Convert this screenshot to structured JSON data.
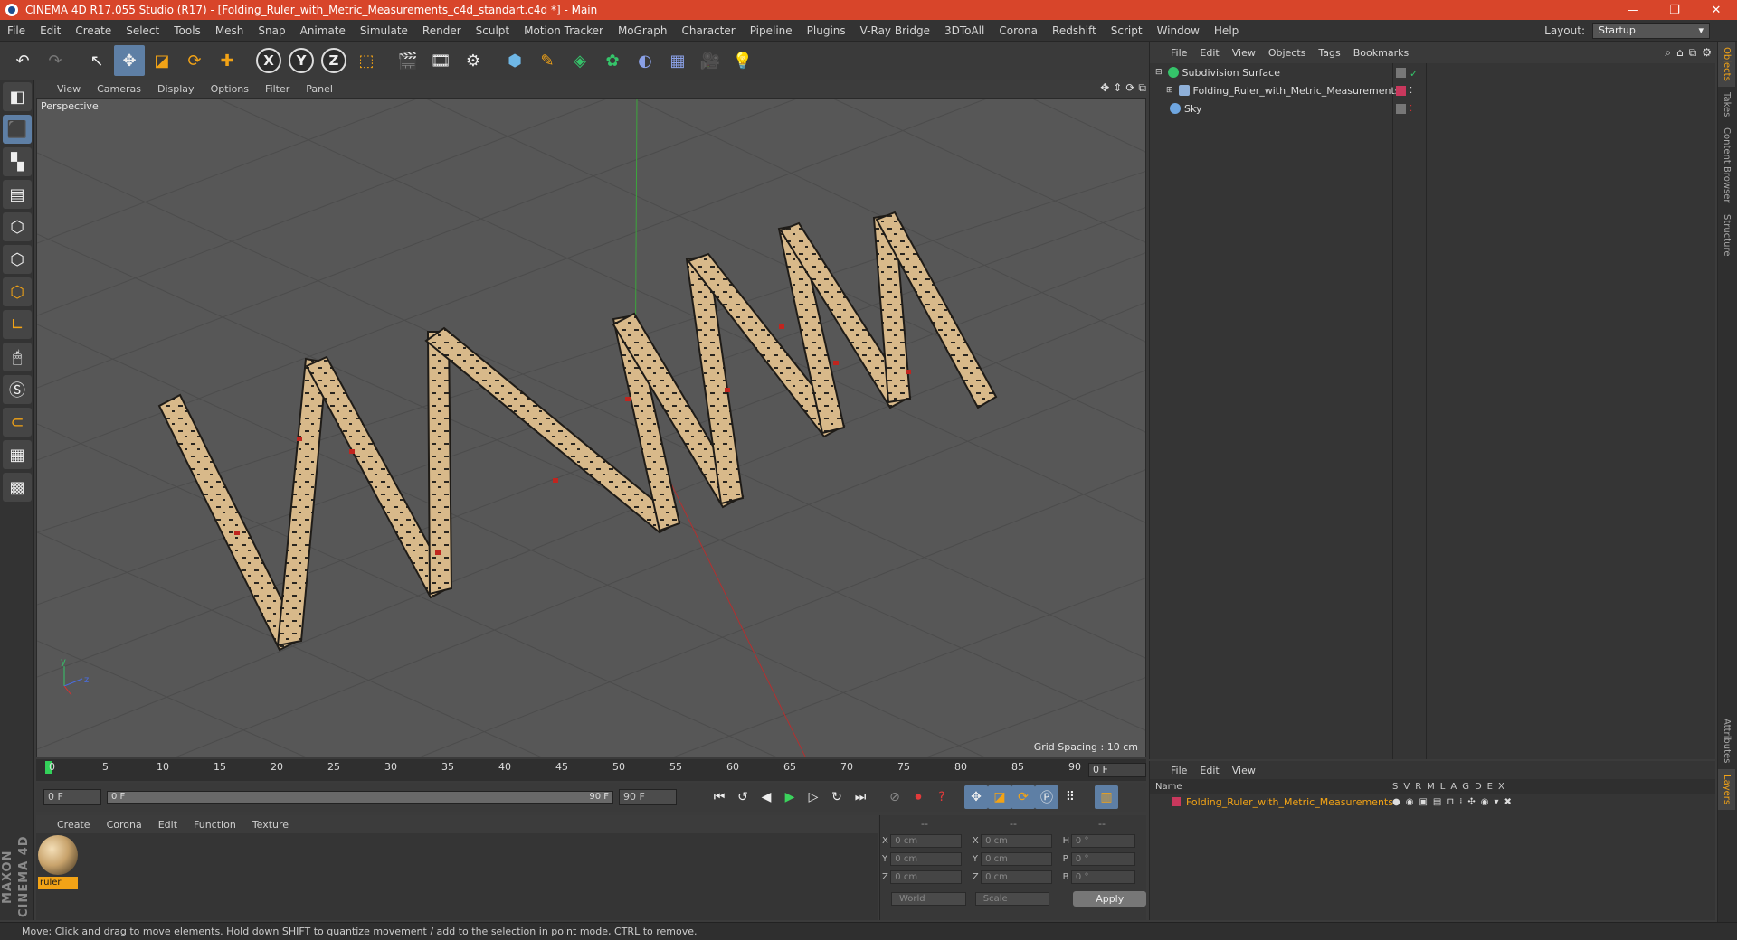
{
  "window": {
    "title": "CINEMA 4D R17.055 Studio (R17) - [Folding_Ruler_with_Metric_Measurements_c4d_standart.c4d *] - Main",
    "minimize": "—",
    "restore": "❐",
    "close": "✕"
  },
  "menu": [
    "File",
    "Edit",
    "Create",
    "Select",
    "Tools",
    "Mesh",
    "Snap",
    "Animate",
    "Simulate",
    "Render",
    "Sculpt",
    "Motion Tracker",
    "MoGraph",
    "Character",
    "Pipeline",
    "Plugins",
    "V-Ray Bridge",
    "3DToAll",
    "Corona",
    "Redshift",
    "Script",
    "Window",
    "Help"
  ],
  "layout": {
    "label": "Layout:",
    "value": "Startup"
  },
  "toolbar": {
    "axis_x": "X",
    "axis_y": "Y",
    "axis_z": "Z"
  },
  "viewport": {
    "menu": [
      "View",
      "Cameras",
      "Display",
      "Options",
      "Filter",
      "Panel"
    ],
    "label": "Perspective",
    "grid_spacing": "Grid Spacing : 10 cm",
    "axis_labels": {
      "y": "y",
      "z": "z"
    }
  },
  "timeline": {
    "ticks": [
      "0",
      "5",
      "10",
      "15",
      "20",
      "25",
      "30",
      "35",
      "40",
      "45",
      "50",
      "55",
      "60",
      "65",
      "70",
      "75",
      "80",
      "85",
      "90"
    ],
    "current_frame": "0 F",
    "start": "0 F",
    "range_start": "0 F",
    "range_end": "90 F",
    "end": "90 F"
  },
  "material_manager": {
    "menu": [
      "Create",
      "Corona",
      "Edit",
      "Function",
      "Texture"
    ],
    "material_name": "ruler"
  },
  "coordinates": {
    "headers": [
      "--",
      "--",
      "--"
    ],
    "rows": [
      {
        "a": "X",
        "av": "0 cm",
        "b": "X",
        "bv": "0 cm",
        "c": "H",
        "cv": "0 °"
      },
      {
        "a": "Y",
        "av": "0 cm",
        "b": "Y",
        "bv": "0 cm",
        "c": "P",
        "cv": "0 °"
      },
      {
        "a": "Z",
        "av": "0 cm",
        "b": "Z",
        "bv": "0 cm",
        "c": "B",
        "cv": "0 °"
      }
    ],
    "world": "World",
    "scale": "Scale",
    "apply": "Apply"
  },
  "object_manager": {
    "menu": [
      "File",
      "Edit",
      "View",
      "Objects",
      "Tags",
      "Bookmarks"
    ],
    "objects": [
      {
        "name": "Subdivision Surface",
        "color": "#35c46a"
      },
      {
        "name": "Folding_Ruler_with_Metric_Measurements",
        "color": "#8fb0d8"
      },
      {
        "name": "Sky",
        "color": "#6fa6e0"
      }
    ]
  },
  "right_tabs": [
    "Objects",
    "Takes",
    "Content Browser",
    "Structure",
    "Attributes",
    "Layers"
  ],
  "layer_manager": {
    "menu": [
      "File",
      "Edit",
      "View"
    ],
    "header_name": "Name",
    "columns": [
      "S",
      "V",
      "R",
      "M",
      "L",
      "A",
      "G",
      "D",
      "E",
      "X"
    ],
    "layer_name": "Folding_Ruler_with_Metric_Measurements"
  },
  "status": "Move: Click and drag to move elements. Hold down SHIFT to quantize movement / add to the selection in point mode, CTRL to remove.",
  "colors": {
    "titlebar": "#d8452a",
    "accent": "#f2a316",
    "active_tool": "#5e7fa5"
  }
}
